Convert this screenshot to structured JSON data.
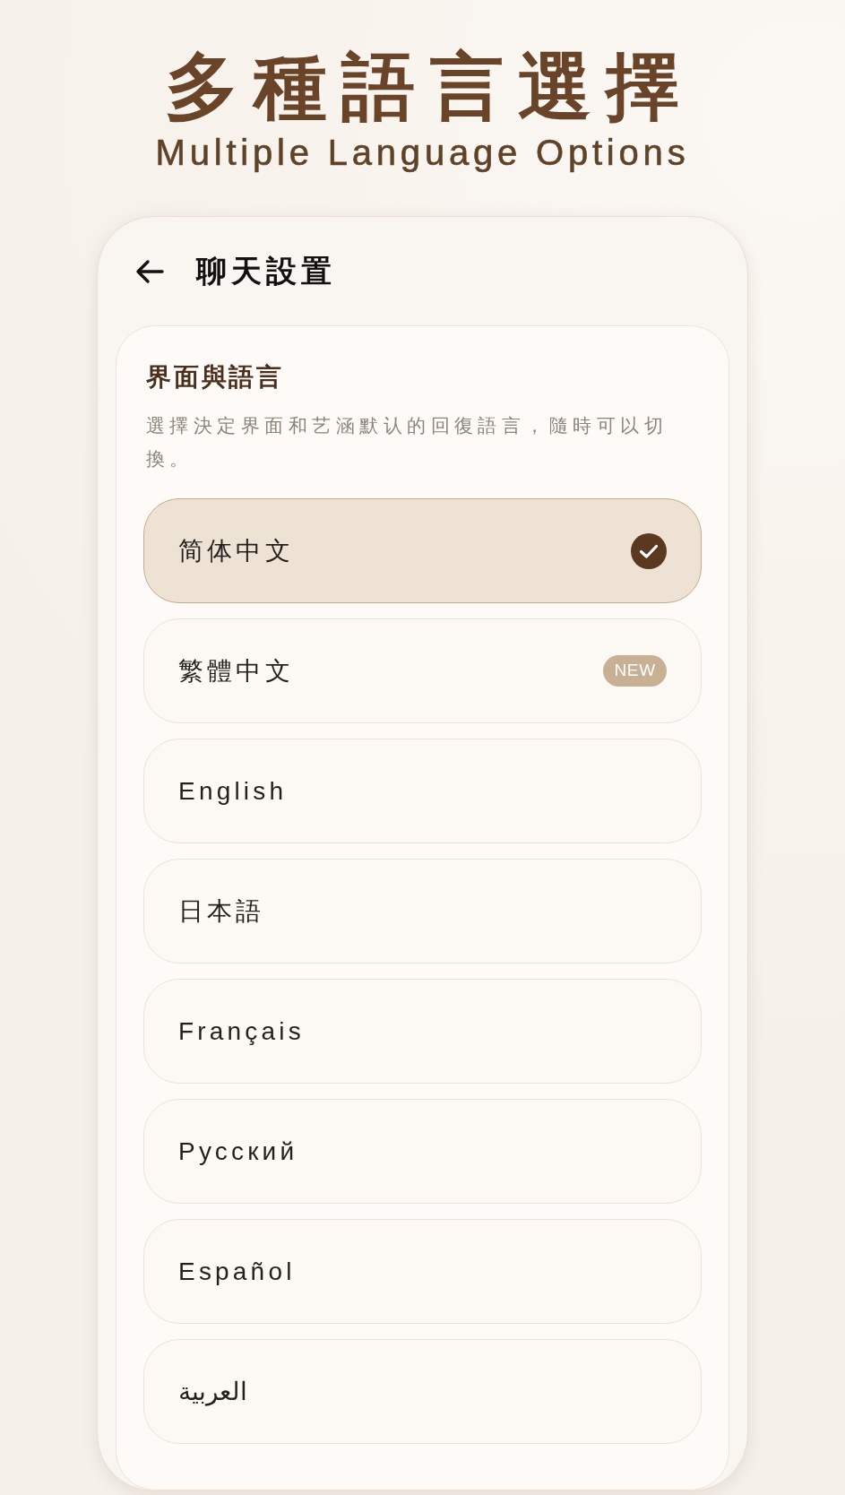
{
  "header": {
    "title": "多種語言選擇",
    "subtitle": "Multiple Language Options"
  },
  "app_bar": {
    "title": "聊天設置"
  },
  "section": {
    "title": "界面與語言",
    "description": "選擇決定界面和艺涵默认的回復語言，隨時可以切換。"
  },
  "languages": [
    {
      "label": "简体中文",
      "selected": true
    },
    {
      "label": "繁體中文",
      "selected": false,
      "badge": "NEW"
    },
    {
      "label": "English",
      "selected": false
    },
    {
      "label": "日本語",
      "selected": false
    },
    {
      "label": "Français",
      "selected": false
    },
    {
      "label": "Русский",
      "selected": false
    },
    {
      "label": "Español",
      "selected": false
    },
    {
      "label": "العربية",
      "selected": false
    }
  ]
}
